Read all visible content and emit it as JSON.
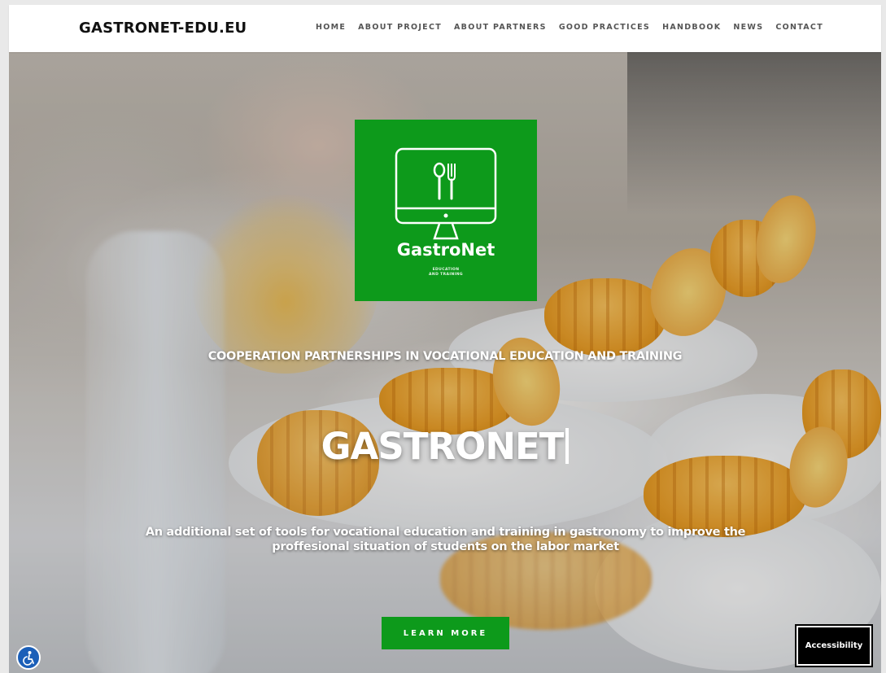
{
  "header": {
    "brand": "GASTRONET-EDU.EU",
    "nav": [
      {
        "label": "HOME"
      },
      {
        "label": "ABOUT PROJECT"
      },
      {
        "label": "ABOUT PARTNERS"
      },
      {
        "label": "GOOD PRACTICES"
      },
      {
        "label": "HANDBOOK"
      },
      {
        "label": "NEWS"
      },
      {
        "label": "CONTACT"
      }
    ]
  },
  "logo": {
    "name": "GastroNet",
    "subtitle_line1": "EDUCATION",
    "subtitle_line2": "AND TRAINING",
    "icon": "monitor-cutlery-icon",
    "background_color": "#0d9a1b"
  },
  "hero": {
    "tagline": "COOPERATION PARTNERSHIPS IN VOCATIONAL EDUCATION AND TRAINING",
    "title": "GASTRONET",
    "description": "An additional set of tools for vocational education and training in gastronomy to improve the proffesional situation of students on the labor market",
    "cta_label": "LEARN MORE",
    "cta_color": "#0d9a1b"
  },
  "accessibility": {
    "button_label": "Accessibility",
    "widget_icon": "accessibility-person-icon",
    "widget_color": "#1b5fb8"
  }
}
